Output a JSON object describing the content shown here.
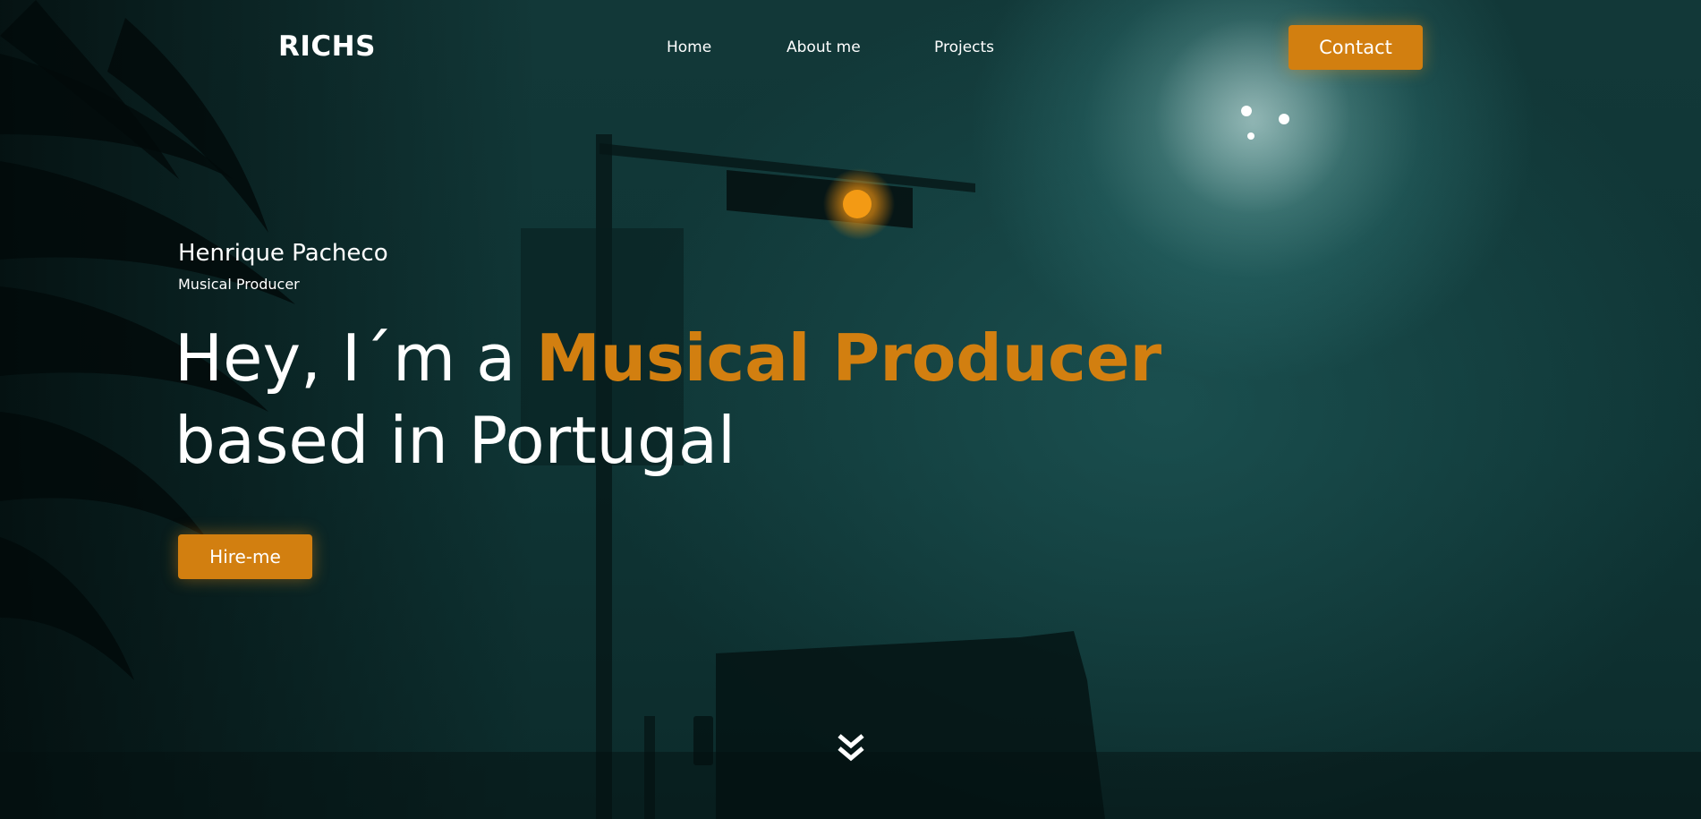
{
  "header": {
    "logo": "RICHS",
    "nav": [
      {
        "label": "Home"
      },
      {
        "label": "About me"
      },
      {
        "label": "Projects"
      }
    ],
    "contact_label": "Contact"
  },
  "hero": {
    "name": "Henrique Pacheco",
    "role": "Musical Producer",
    "headline_prefix": "Hey, I´m a ",
    "headline_accent": "Musical Producer",
    "headline_line2": "based in Portugal",
    "cta_label": "Hire-me",
    "scroll_icon": "double-chevron-down-icon"
  },
  "colors": {
    "accent": "#d27f10",
    "text": "#ffffff",
    "background": "#0f3535"
  }
}
